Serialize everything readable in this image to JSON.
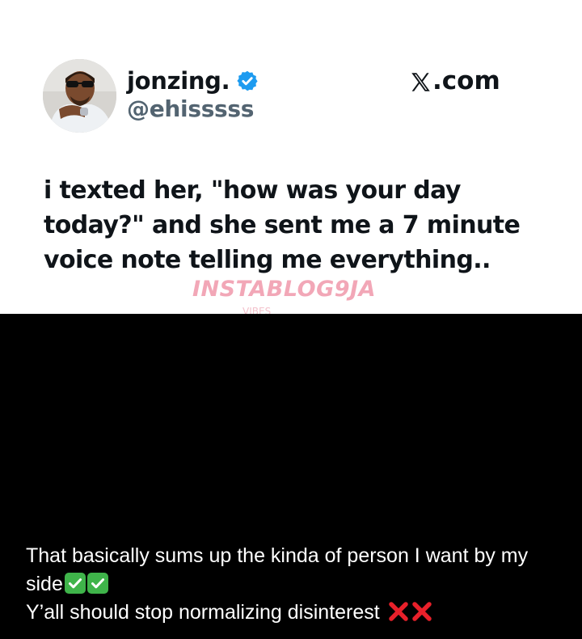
{
  "tweet": {
    "display_name": "jonzing.",
    "handle": "@ehisssss",
    "site_label": ".com",
    "text": "i texted her, \"how was your day\ntoday?\" and she sent me a 7 minute\nvoice note telling me everything..",
    "watermark": "INSTABLOG9JA",
    "watermark_sub": "VIBES"
  },
  "caption": {
    "line1": "That basically sums up the kinda of person I want by my side",
    "line2": "Y’all should stop normalizing disinterest"
  },
  "icons": {
    "verified": "verified-badge-icon",
    "x_logo": "x-logo-icon",
    "check": "check-mark-emoji",
    "cross": "cross-mark-emoji"
  },
  "colors": {
    "verified_blue": "#1d9bf0",
    "text_dark": "#0f1419",
    "handle_gray": "#536471",
    "check_green": "#3fb44a",
    "cross_red": "#e8202a",
    "watermark_pink": "#f2a7b7"
  }
}
